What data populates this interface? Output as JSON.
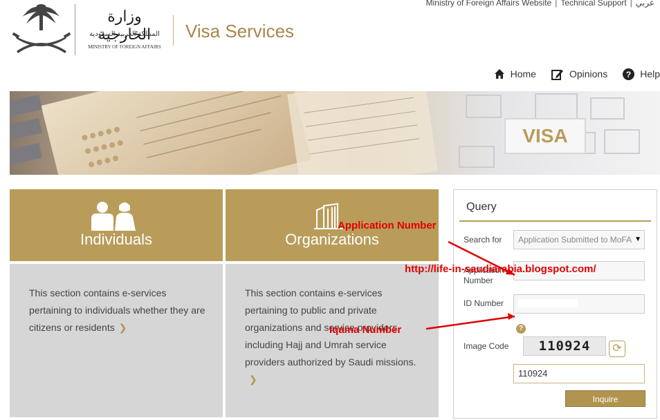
{
  "header": {
    "site_title": "Visa Services",
    "logo_arabic_name": "وزارة الخارجية",
    "logo_arabic_sub": "المملكة العربية السعودية",
    "logo_english": "MINISTRY OF FOREIGN AFFAIRS",
    "top_links": [
      "Ministry of Foreign Affairs Website",
      "Technical Support",
      "عربي"
    ]
  },
  "nav": {
    "home": "Home",
    "opinions": "Opinions",
    "help": "Help"
  },
  "banner": {
    "visa_text": "VISA"
  },
  "cards": {
    "individuals": {
      "title": "Individuals",
      "text": "This section contains e-services pertaining to individuals whether they are citizens or residents"
    },
    "organizations": {
      "title": "Organizations",
      "text": "This section contains e-services pertaining to public and private organizations and service providers, including Hajj and Umrah service providers authorized by Saudi missions."
    }
  },
  "query": {
    "title": "Query",
    "search_for_label": "Search for",
    "search_for_value": "Application Submitted to MoFA",
    "application_number_label": "Application Number",
    "id_number_label": "ID Number",
    "image_code_label": "Image Code",
    "captcha_text": "110924",
    "image_code_value": "110924",
    "inquire_label": "Inquire"
  },
  "annotations": {
    "application_number": "Application Number",
    "url": "http://life-in-saudiarabia.blogspot.com/",
    "iqama_number": "Iqama Number"
  },
  "colors": {
    "accent": "#b99c5a",
    "panel_gray": "#d6d6d6",
    "annotation_red": "#e00000"
  }
}
